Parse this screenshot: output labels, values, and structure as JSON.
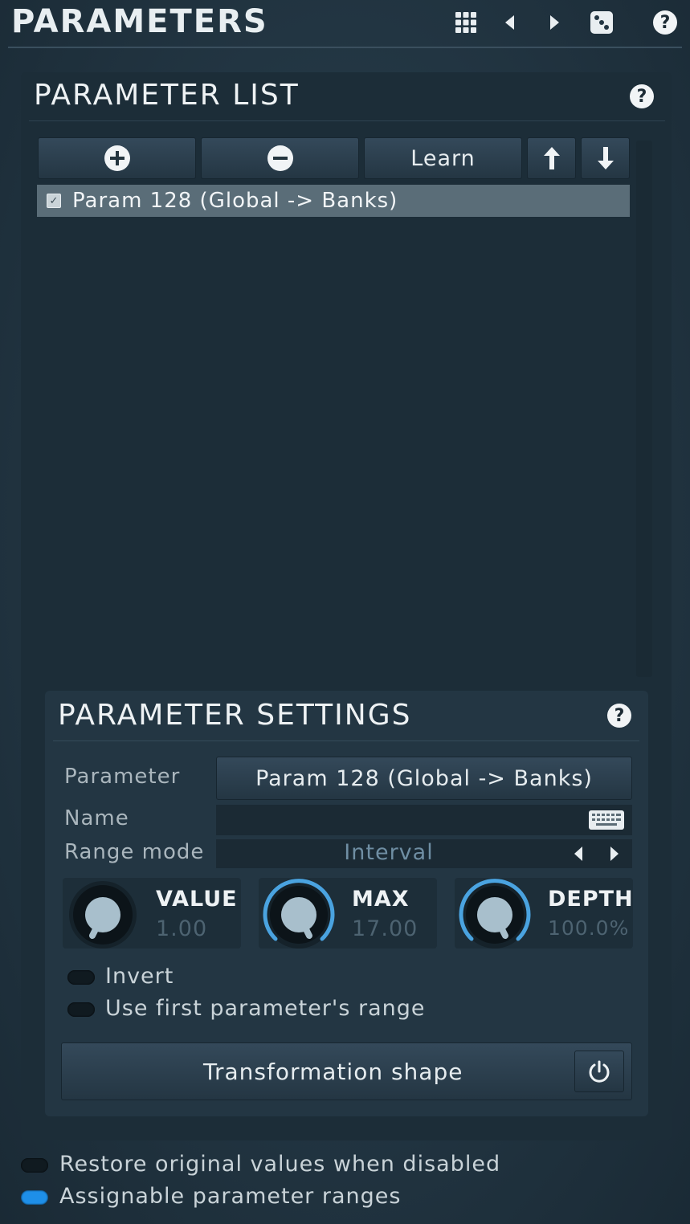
{
  "header": {
    "title": "PARAMETERS",
    "icons": [
      "grid-icon",
      "prev-icon",
      "next-icon",
      "dice-icon",
      "help-icon"
    ],
    "help_glyph": "?"
  },
  "parameter_list": {
    "title": "PARAMETER LIST",
    "help_glyph": "?",
    "toolbar": {
      "add_icon": "plus-circle-icon",
      "remove_icon": "minus-circle-icon",
      "learn_label": "Learn",
      "up_icon": "arrow-up-icon",
      "down_icon": "arrow-down-icon"
    },
    "items": [
      {
        "label": "Param 128 (Global -> Banks)",
        "checked": true
      }
    ]
  },
  "parameter_settings": {
    "title": "PARAMETER SETTINGS",
    "help_glyph": "?",
    "parameter_label": "Parameter",
    "parameter_value": "Param 128 (Global -> Banks)",
    "name_label": "Name",
    "name_value": "",
    "range_mode_label": "Range mode",
    "range_mode_value": "Interval",
    "knobs": [
      {
        "title": "VALUE",
        "value": "1.00"
      },
      {
        "title": "MAX",
        "value": "17.00"
      },
      {
        "title": "DEPTH",
        "value": "100.0%"
      }
    ],
    "invert_label": "Invert",
    "invert_on": false,
    "use_first_range_label": "Use first parameter's range",
    "use_first_range_on": false,
    "transformation_label": "Transformation shape"
  },
  "footer": {
    "restore_label": "Restore original values when disabled",
    "restore_on": false,
    "assignable_label": "Assignable parameter ranges",
    "assignable_on": true
  },
  "colors": {
    "accent": "#1e8fe8",
    "knob_ring": "#4aa3e0",
    "selected_row": "#5a6d78"
  }
}
